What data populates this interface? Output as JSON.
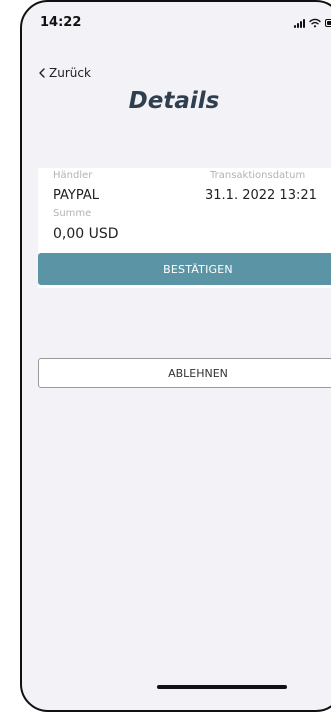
{
  "status_bar": {
    "time": "14:22",
    "icons": [
      "signal-icon",
      "wifi-icon",
      "battery-icon"
    ]
  },
  "nav": {
    "back_label": "Zurück",
    "back_icon": "chevron-left-icon"
  },
  "page": {
    "title": "Details"
  },
  "details": {
    "merchant_label": "Händler",
    "merchant_value": "PAYPAL",
    "date_label": "Transaktionsdatum",
    "date_value": "31.1. 2022 13:21",
    "amount_label": "Summe",
    "amount_value": "0,00 USD"
  },
  "actions": {
    "confirm_label": "BESTÄTIGEN",
    "reject_label": "ABLEHNEN"
  },
  "colors": {
    "primary": "#5b95a5",
    "title": "#2f3f4f",
    "background": "#f2f2f7"
  }
}
